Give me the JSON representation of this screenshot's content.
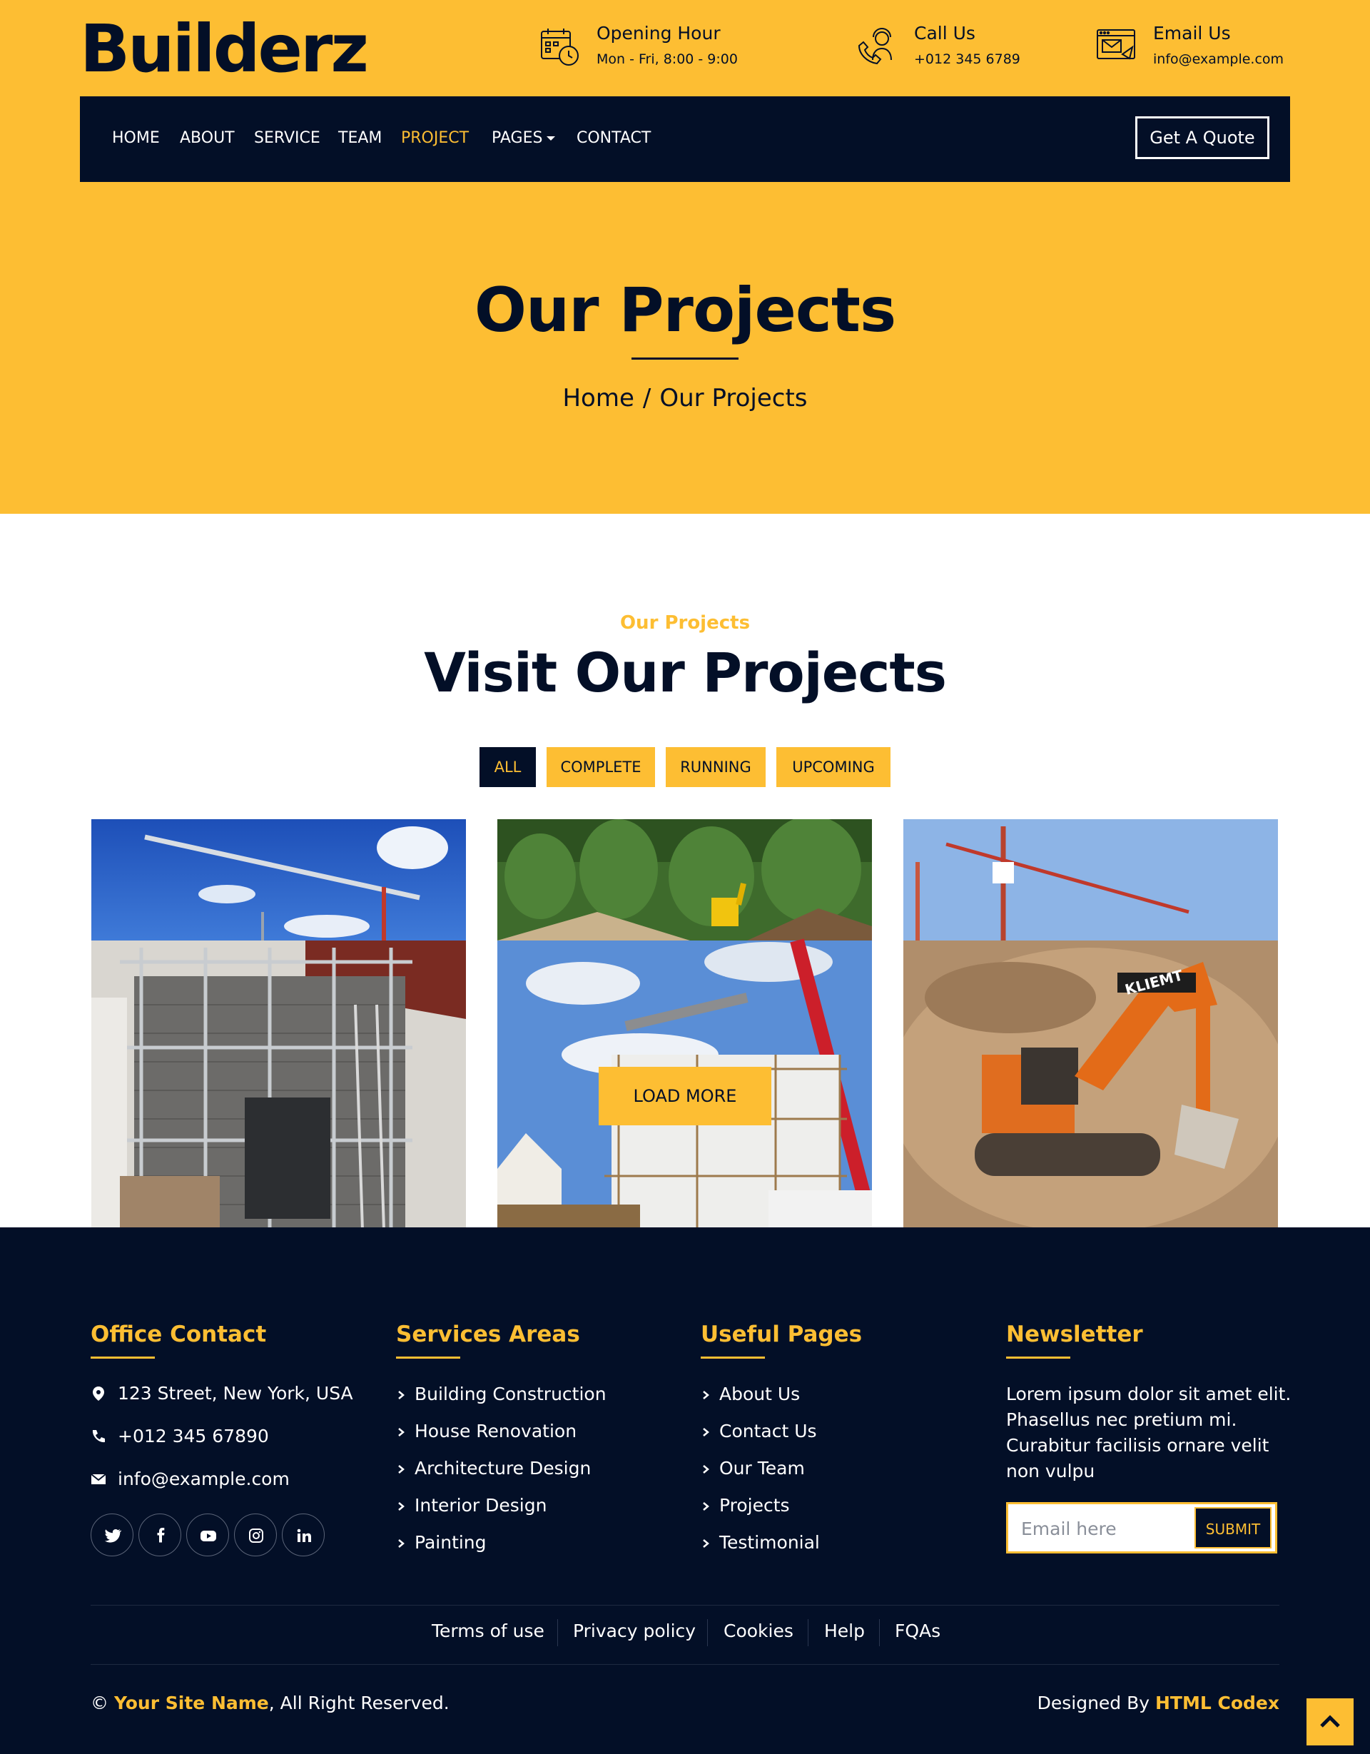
{
  "brand": {
    "name": "Builderz"
  },
  "topbar": {
    "opening": {
      "title": "Opening Hour",
      "text": "Mon - Fri, 8:00 - 9:00"
    },
    "call": {
      "title": "Call Us",
      "text": "+012 345 6789"
    },
    "email": {
      "title": "Email Us",
      "text": "info@example.com"
    }
  },
  "nav": {
    "items": [
      "HOME",
      "ABOUT",
      "SERVICE",
      "TEAM",
      "PROJECT",
      "PAGES",
      "CONTACT"
    ],
    "active": "PROJECT",
    "quote_label": "Get A Quote"
  },
  "hero": {
    "title": "Our Projects",
    "breadcrumb": [
      "Home",
      "Our Projects"
    ]
  },
  "projects": {
    "subtitle": "Our Projects",
    "title": "Visit Our Projects",
    "filters": [
      "ALL",
      "COMPLETE",
      "RUNNING",
      "UPCOMING"
    ],
    "active_filter": "ALL",
    "load_more": "LOAD MORE"
  },
  "footer": {
    "office": {
      "heading": "Office Contact",
      "address": "123 Street, New York, USA",
      "phone": "+012 345 67890",
      "email": "info@example.com",
      "social": [
        "twitter-icon",
        "facebook-icon",
        "youtube-icon",
        "instagram-icon",
        "linkedin-icon"
      ]
    },
    "services": {
      "heading": "Services Areas",
      "items": [
        "Building Construction",
        "House Renovation",
        "Architecture Design",
        "Interior Design",
        "Painting"
      ]
    },
    "pages": {
      "heading": "Useful Pages",
      "items": [
        "About Us",
        "Contact Us",
        "Our Team",
        "Projects",
        "Testimonial"
      ]
    },
    "newsletter": {
      "heading": "Newsletter",
      "text": "Lorem ipsum dolor sit amet elit. Phasellus nec pretium mi. Curabitur facilisis ornare velit non vulpu",
      "placeholder": "Email here",
      "submit": "SUBMIT"
    },
    "links": [
      "Terms of use",
      "Privacy policy",
      "Cookies",
      "Help",
      "FQAs"
    ],
    "copyright": {
      "prefix": "© ",
      "site": "Your Site Name",
      "suffix": ", All Right Reserved."
    },
    "designed": {
      "prefix": "Designed By ",
      "by": "HTML Codex"
    }
  },
  "colors": {
    "accent": "#fdbe33",
    "dark": "#030f27"
  }
}
